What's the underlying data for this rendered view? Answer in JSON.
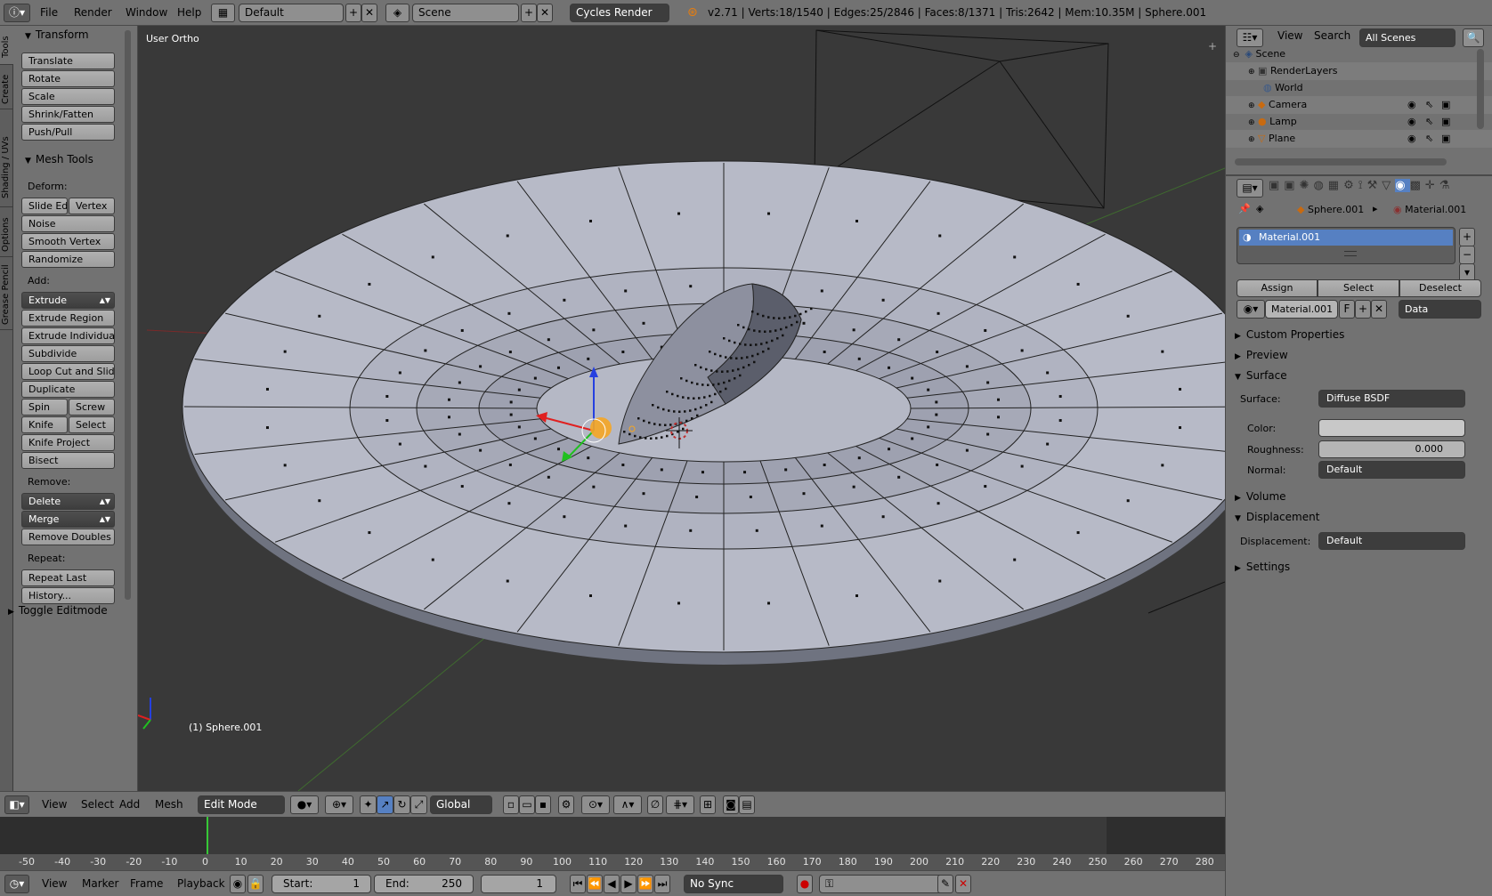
{
  "topbar": {
    "menus": [
      "File",
      "Render",
      "Window",
      "Help"
    ],
    "layout": "Default",
    "scene": "Scene",
    "engine": "Cycles Render",
    "stats": "v2.71 | Verts:18/1540 | Edges:25/2846 | Faces:8/1371 | Tris:2642 | Mem:10.35M | Sphere.001"
  },
  "tabs": [
    "Tools",
    "Create",
    "Shading / UVs",
    "Options",
    "Grease Pencil"
  ],
  "toolshelf": {
    "transform_title": "Transform",
    "transform": [
      "Translate",
      "Rotate",
      "Scale",
      "Shrink/Fatten",
      "Push/Pull"
    ],
    "meshtools_title": "Mesh Tools",
    "deform_label": "Deform:",
    "slide_edge": "Slide Ed",
    "vertex": "Vertex",
    "noise": "Noise",
    "smooth_vertex": "Smooth Vertex",
    "randomize": "Randomize",
    "add_label": "Add:",
    "extrude": "Extrude",
    "extrude_region": "Extrude Region",
    "extrude_individual": "Extrude Individual",
    "subdivide": "Subdivide",
    "loop_cut": "Loop Cut and Slide",
    "duplicate": "Duplicate",
    "spin": "Spin",
    "screw": "Screw",
    "knife": "Knife",
    "select": "Select",
    "knife_project": "Knife Project",
    "bisect": "Bisect",
    "remove_label": "Remove:",
    "delete": "Delete",
    "merge": "Merge",
    "remove_doubles": "Remove Doubles",
    "repeat_label": "Repeat:",
    "repeat_last": "Repeat Last",
    "history": "History...",
    "toggle_editmode": "Toggle Editmode"
  },
  "viewport": {
    "view_label": "User Ortho",
    "object_label": "(1) Sphere.001"
  },
  "viewheader": {
    "menus": [
      "View",
      "Select",
      "Add",
      "Mesh"
    ],
    "mode": "Edit Mode",
    "orientation": "Global"
  },
  "timeline": {
    "ticks": [
      "-50",
      "-40",
      "-30",
      "-20",
      "-10",
      "0",
      "10",
      "20",
      "30",
      "40",
      "50",
      "60",
      "70",
      "80",
      "90",
      "100",
      "110",
      "120",
      "130",
      "140",
      "150",
      "160",
      "170",
      "180",
      "190",
      "200",
      "210",
      "220",
      "230",
      "240",
      "250",
      "260",
      "270",
      "280"
    ],
    "menus": [
      "View",
      "Marker",
      "Frame",
      "Playback"
    ],
    "start": "Start:",
    "start_val": "1",
    "end": "End:",
    "end_val": "250",
    "current": "1",
    "sync": "No Sync"
  },
  "outliner": {
    "view": "View",
    "search": "Search",
    "scenes": "All Scenes",
    "items": [
      "Scene",
      "RenderLayers",
      "World",
      "Camera",
      "Lamp",
      "Plane"
    ]
  },
  "props": {
    "breadcrumb_obj": "Sphere.001",
    "breadcrumb_mat": "Material.001",
    "slot": "Material.001",
    "assign": "Assign",
    "select": "Select",
    "deselect": "Deselect",
    "mat_name": "Material.001",
    "f": "F",
    "link": "Data",
    "custom_props": "Custom Properties",
    "preview": "Preview",
    "surface_title": "Surface",
    "surface_label": "Surface:",
    "surface_val": "Diffuse BSDF",
    "color_label": "Color:",
    "roughness_label": "Roughness:",
    "roughness_val": "0.000",
    "normal_label": "Normal:",
    "normal_val": "Default",
    "volume": "Volume",
    "displacement_title": "Displacement",
    "displacement_label": "Displacement:",
    "displacement_val": "Default",
    "settings": "Settings"
  },
  "colors": {
    "selection": "#5680c2",
    "accent": "#f5a623"
  }
}
